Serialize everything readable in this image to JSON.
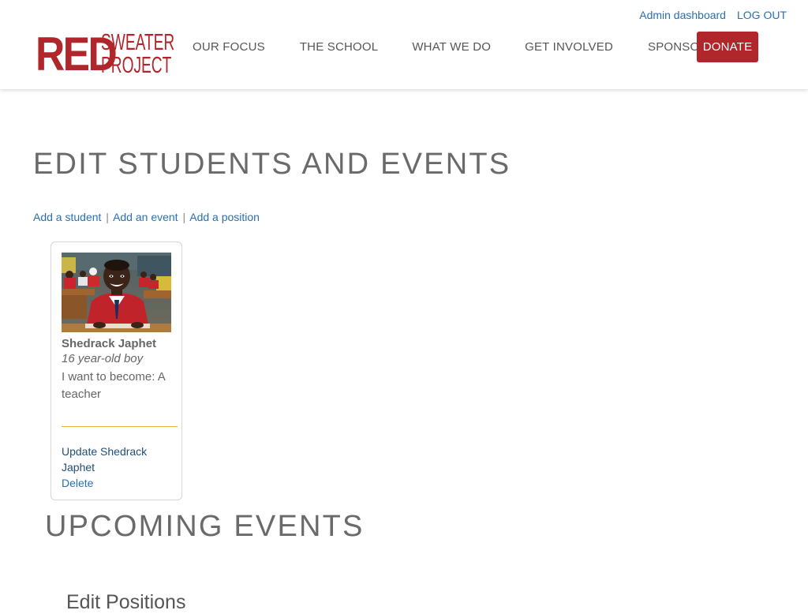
{
  "header": {
    "admin_links": {
      "dashboard_label": "Admin dashboard",
      "logout_label": "LOG OUT"
    },
    "logo": {
      "line_red": "RED",
      "line_sweater": "SWEATER",
      "line_project": "PROJECT",
      "alt": "Red Sweater Project"
    },
    "nav": [
      {
        "label": "OUR FOCUS"
      },
      {
        "label": "THE SCHOOL"
      },
      {
        "label": "WHAT WE DO"
      },
      {
        "label": "GET INVOLVED"
      },
      {
        "label": "SPONSOR"
      }
    ],
    "donate_label": "DONATE"
  },
  "main": {
    "page_title": "EDIT STUDENTS AND EVENTS",
    "actions": {
      "add_student": "Add a student",
      "add_event": "Add an event",
      "add_position": "Add a position",
      "separator": "|"
    },
    "students": [
      {
        "name": "Shedrack Japhet",
        "age_desc": "16 year-old boy",
        "goal": "I want to become: A teacher",
        "update_label": "Update Shedrack Japhet",
        "delete_label": "Delete",
        "photo": "student-photo"
      }
    ],
    "upcoming_events_title": "UPCOMING EVENTS",
    "edit_positions_title": "Edit Positions"
  },
  "colors": {
    "brand_red": "#b0262b",
    "link_blue": "#2a6fb5",
    "dark_link": "#1f4e79",
    "divider_gold": "#e3b23a",
    "heading_gray": "#6a6a6a"
  }
}
